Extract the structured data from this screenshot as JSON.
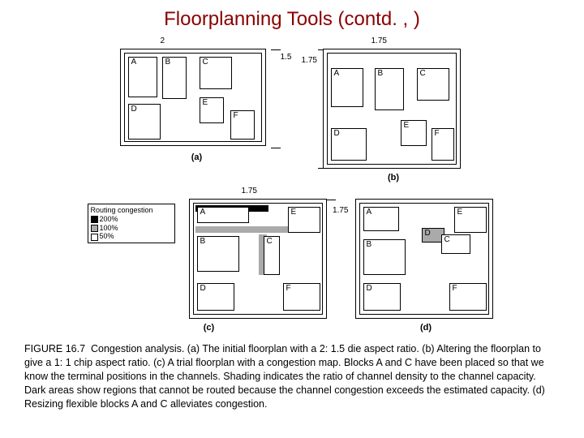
{
  "title": "Floorplanning Tools (contd. , )",
  "figure_number": "FIGURE 16.7",
  "caption": "Congestion analysis. (a) The initial floorplan with a 2: 1.5 die aspect ratio. (b) Altering the floorplan to give a 1: 1 chip aspect ratio. (c) A trial floorplan with a congestion map. Blocks A and C have been placed so that we know the terminal positions in the channels. Shading indicates the ratio of channel density to the channel capacity. Dark areas show regions that cannot be routed because the channel congestion exceeds the estimated capacity. (d) Resizing flexible blocks A and C alleviates congestion.",
  "panels": {
    "a": {
      "label": "(a)",
      "chip_w": "2",
      "chip_h": "1.5",
      "blocks": {
        "A": "A",
        "B": "B",
        "C": "C",
        "D": "D",
        "E": "E",
        "F": "F"
      }
    },
    "b": {
      "label": "(b)",
      "chip_w": "1.75",
      "chip_h": "1.75",
      "blocks": {
        "A": "A",
        "B": "B",
        "C": "C",
        "D": "D",
        "E": "E",
        "F": "F"
      }
    },
    "c": {
      "label": "(c)",
      "chip_w": "1.75",
      "chip_h": "1.75",
      "legend_title": "Routing congestion",
      "legend": [
        {
          "label": "200%",
          "shade": "#000"
        },
        {
          "label": "100%",
          "shade": "#aaa"
        },
        {
          "label": "50%",
          "shade": "#fff"
        }
      ],
      "blocks": {
        "A": "A",
        "B": "B",
        "C": "C",
        "D": "D",
        "E": "E",
        "F": "F"
      }
    },
    "d": {
      "label": "(d)",
      "blocks": {
        "A": "A",
        "B": "B",
        "C": "C",
        "D": "D",
        "E": "E",
        "F": "F"
      }
    }
  }
}
